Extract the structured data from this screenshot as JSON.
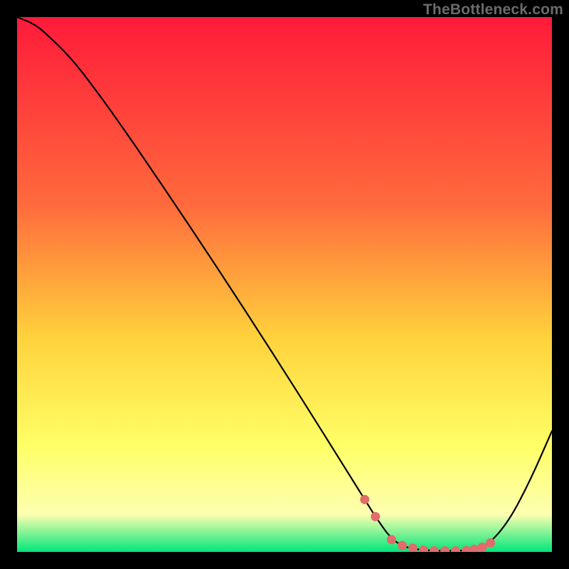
{
  "watermark": "TheBottleneck.com",
  "colors": {
    "black": "#000000",
    "curve": "#000000",
    "marker": "#e26b6b",
    "grad_top": "#ff1a3a",
    "grad_mid1": "#ff6a3c",
    "grad_mid2": "#ffd23c",
    "grad_mid3": "#ffff66",
    "grad_mid4": "#fdffb0",
    "grad_bottom": "#00e67a"
  },
  "chart_data": {
    "type": "line",
    "title": "",
    "xlabel": "",
    "ylabel": "",
    "xlim": [
      0,
      100
    ],
    "ylim": [
      0,
      100
    ],
    "x": [
      0,
      3,
      5,
      10,
      15,
      20,
      25,
      30,
      35,
      40,
      45,
      50,
      55,
      60,
      63,
      65,
      67,
      70,
      73,
      76,
      79,
      82,
      85,
      88,
      92,
      96,
      100
    ],
    "values": [
      100,
      98.8,
      97.3,
      92.5,
      86,
      79,
      71.7,
      64.3,
      56.8,
      49.2,
      41.5,
      33.7,
      25.8,
      17.8,
      13,
      9.8,
      6.6,
      2.3,
      0.7,
      0.33,
      0.2,
      0.2,
      0.33,
      1.2,
      5.8,
      13.5,
      22.6
    ],
    "series": [
      {
        "name": "bottleneck-curve",
        "x": [
          0,
          3,
          5,
          10,
          15,
          20,
          25,
          30,
          35,
          40,
          45,
          50,
          55,
          60,
          63,
          65,
          67,
          70,
          73,
          76,
          79,
          82,
          85,
          88,
          92,
          96,
          100
        ],
        "y": [
          100,
          98.8,
          97.3,
          92.5,
          86,
          79,
          71.7,
          64.3,
          56.8,
          49.2,
          41.5,
          33.7,
          25.8,
          17.8,
          13,
          9.8,
          6.6,
          2.3,
          0.7,
          0.33,
          0.2,
          0.2,
          0.33,
          1.2,
          5.8,
          13.5,
          22.6
        ]
      },
      {
        "name": "optimal-range-markers",
        "x": [
          65,
          67,
          70,
          72,
          74,
          76,
          78,
          80,
          82,
          84,
          85.5,
          87,
          88.5
        ],
        "y": [
          9.8,
          6.6,
          2.3,
          1.2,
          0.7,
          0.33,
          0.22,
          0.2,
          0.2,
          0.27,
          0.5,
          0.9,
          1.7
        ]
      }
    ]
  }
}
